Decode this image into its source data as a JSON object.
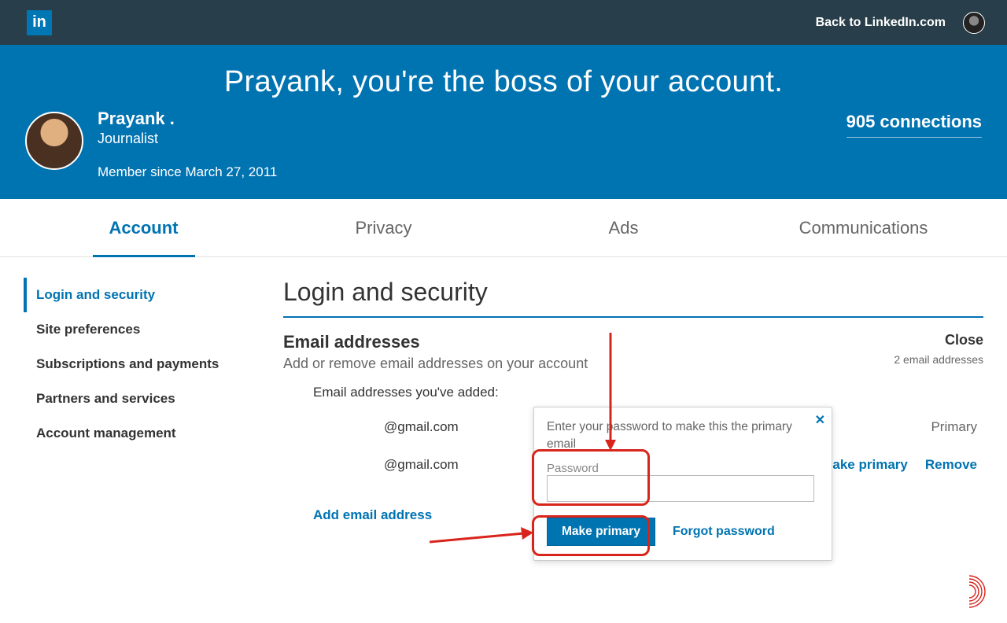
{
  "topnav": {
    "back_label": "Back to LinkedIn.com"
  },
  "hero": {
    "title": "Prayank, you're the boss of your account.",
    "name": "Prayank .",
    "role": "Journalist",
    "member_since": "Member since March 27, 2011",
    "connections": "905 connections"
  },
  "tabs": [
    "Account",
    "Privacy",
    "Ads",
    "Communications"
  ],
  "sidebar": {
    "items": [
      "Login and security",
      "Site preferences",
      "Subscriptions and payments",
      "Partners and services",
      "Account management"
    ]
  },
  "main": {
    "heading": "Login and security",
    "section_title": "Email addresses",
    "section_sub": "Add or remove email addresses on your account",
    "close_label": "Close",
    "count_text": "2 email addresses",
    "added_label": "Email addresses you've added:",
    "emails": [
      {
        "addr": "@gmail.com",
        "primary_label": "Primary"
      },
      {
        "addr": "@gmail.com",
        "make_primary": "Make primary",
        "remove": "Remove"
      }
    ],
    "add_link": "Add email address"
  },
  "popover": {
    "message": "Enter your password to make this the primary email",
    "password_label": "Password",
    "button": "Make primary",
    "forgot": "Forgot password",
    "close_icon": "✕"
  }
}
